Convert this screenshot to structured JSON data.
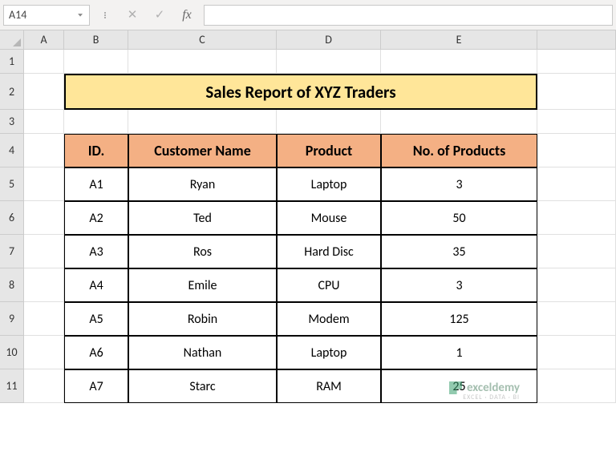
{
  "formula_bar": {
    "name_box": "A14",
    "cancel": "✕",
    "confirm": "✓",
    "fx": "fx",
    "formula": ""
  },
  "columns": [
    "A",
    "B",
    "C",
    "D",
    "E"
  ],
  "rows": [
    "1",
    "2",
    "3",
    "4",
    "5",
    "6",
    "7",
    "8",
    "9",
    "10",
    "11"
  ],
  "col_widths": {
    "A": 50,
    "B": 80,
    "C": 185,
    "D": 130,
    "E": 195,
    "F": 98
  },
  "title": "Sales Report of XYZ Traders",
  "headers": {
    "id": "ID.",
    "name": "Customer Name",
    "product": "Product",
    "qty": "No. of Products"
  },
  "data": [
    {
      "id": "A1",
      "name": "Ryan",
      "product": "Laptop",
      "qty": "3"
    },
    {
      "id": "A2",
      "name": "Ted",
      "product": "Mouse",
      "qty": "50"
    },
    {
      "id": "A3",
      "name": "Ros",
      "product": "Hard Disc",
      "qty": "35"
    },
    {
      "id": "A4",
      "name": "Emile",
      "product": "CPU",
      "qty": "3"
    },
    {
      "id": "A5",
      "name": "Robin",
      "product": "Modem",
      "qty": "125"
    },
    {
      "id": "A6",
      "name": "Nathan",
      "product": "Laptop",
      "qty": "1"
    },
    {
      "id": "A7",
      "name": "Starc",
      "product": "RAM",
      "qty": "25"
    }
  ],
  "watermark": {
    "brand": "exceldemy",
    "tag": "EXCEL · DATA · BI"
  }
}
